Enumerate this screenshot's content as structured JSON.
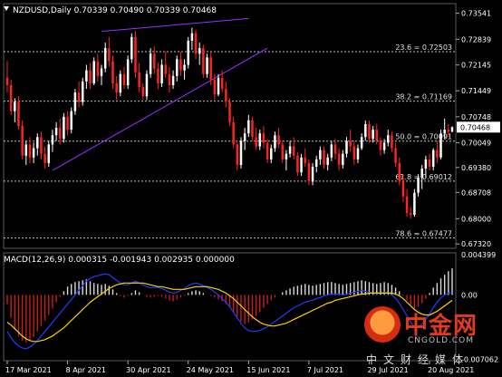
{
  "chart_data": {
    "type": "candlestick",
    "header": {
      "symbol": "NZDUSD,Daily",
      "open": "0.70339",
      "high": "0.70490",
      "low": "0.70339",
      "close": "0.70468"
    },
    "price_axis": {
      "ylim": [
        0.672,
        0.738
      ],
      "ticks": [
        "0.73541",
        "0.72839",
        "0.72145",
        "0.71449",
        "0.70748",
        "0.70049",
        "0.69380",
        "0.68708",
        "0.68000",
        "0.67320"
      ],
      "tick_values": [
        0.73541,
        0.72839,
        0.72145,
        0.71449,
        0.70748,
        0.70049,
        0.6938,
        0.68708,
        0.68,
        0.6732
      ],
      "current_price_label": "0.70468",
      "current_price": 0.70468
    },
    "x_axis": {
      "labels": [
        "17 Mar 2021",
        "8 Apr 2021",
        "30 Apr 2021",
        "24 May 2021",
        "15 Jun 2021",
        "7 Jul 2021",
        "29 Jul 2021",
        "20 Aug 2021"
      ],
      "label_bar_index": [
        0,
        16,
        32,
        48,
        64,
        80,
        96,
        112
      ],
      "bar_count": 119
    },
    "fibonacci": [
      {
        "label": "23.6 = 0.72503",
        "value": 0.72503
      },
      {
        "label": "38.2 = 0.71169",
        "value": 0.71169
      },
      {
        "label": "50.0 = 0.70091",
        "value": 0.70091
      },
      {
        "label": "61.8 = 0.69012",
        "value": 0.69012
      },
      {
        "label": "78.6 = 0.67477",
        "value": 0.67477
      }
    ],
    "trendlines": [
      {
        "from": [
          25,
          0.7305
        ],
        "to": [
          64,
          0.734
        ]
      },
      {
        "from": [
          12,
          0.693
        ],
        "to": [
          69,
          0.726
        ]
      }
    ],
    "candles_ohlc": [
      [
        0.718,
        0.7225,
        0.714,
        0.716
      ],
      [
        0.716,
        0.7175,
        0.708,
        0.709
      ],
      [
        0.709,
        0.7125,
        0.706,
        0.7115
      ],
      [
        0.7115,
        0.713,
        0.704,
        0.705
      ],
      [
        0.705,
        0.7065,
        0.696,
        0.697
      ],
      [
        0.697,
        0.701,
        0.6945,
        0.7
      ],
      [
        0.7,
        0.702,
        0.695,
        0.6965
      ],
      [
        0.6965,
        0.7005,
        0.695,
        0.699
      ],
      [
        0.699,
        0.703,
        0.697,
        0.702
      ],
      [
        0.702,
        0.7035,
        0.696,
        0.6975
      ],
      [
        0.6975,
        0.6995,
        0.6935,
        0.695
      ],
      [
        0.695,
        0.701,
        0.694,
        0.7
      ],
      [
        0.7,
        0.704,
        0.698,
        0.7025
      ],
      [
        0.7025,
        0.706,
        0.701,
        0.7045
      ],
      [
        0.7045,
        0.707,
        0.7,
        0.7015
      ],
      [
        0.7015,
        0.7085,
        0.7005,
        0.7075
      ],
      [
        0.7075,
        0.709,
        0.7025,
        0.704
      ],
      [
        0.704,
        0.71,
        0.703,
        0.709
      ],
      [
        0.709,
        0.715,
        0.708,
        0.714
      ],
      [
        0.714,
        0.717,
        0.71,
        0.7115
      ],
      [
        0.7115,
        0.718,
        0.7105,
        0.717
      ],
      [
        0.717,
        0.7215,
        0.715,
        0.72
      ],
      [
        0.72,
        0.722,
        0.715,
        0.7165
      ],
      [
        0.7165,
        0.7235,
        0.716,
        0.7225
      ],
      [
        0.7225,
        0.7245,
        0.717,
        0.7185
      ],
      [
        0.7185,
        0.7215,
        0.716,
        0.7205
      ],
      [
        0.7205,
        0.7275,
        0.7195,
        0.726
      ],
      [
        0.726,
        0.729,
        0.721,
        0.7225
      ],
      [
        0.7225,
        0.724,
        0.715,
        0.7165
      ],
      [
        0.7165,
        0.7185,
        0.712,
        0.714
      ],
      [
        0.714,
        0.72,
        0.713,
        0.719
      ],
      [
        0.719,
        0.721,
        0.715,
        0.716
      ],
      [
        0.716,
        0.724,
        0.715,
        0.723
      ],
      [
        0.723,
        0.73,
        0.722,
        0.729
      ],
      [
        0.729,
        0.7305,
        0.718,
        0.7195
      ],
      [
        0.7195,
        0.722,
        0.714,
        0.7155
      ],
      [
        0.7155,
        0.7165,
        0.712,
        0.713
      ],
      [
        0.713,
        0.72,
        0.712,
        0.719
      ],
      [
        0.719,
        0.726,
        0.718,
        0.7245
      ],
      [
        0.7245,
        0.7265,
        0.719,
        0.7205
      ],
      [
        0.7205,
        0.722,
        0.715,
        0.7165
      ],
      [
        0.7165,
        0.723,
        0.7155,
        0.7215
      ],
      [
        0.7215,
        0.725,
        0.718,
        0.719
      ],
      [
        0.719,
        0.721,
        0.714,
        0.716
      ],
      [
        0.716,
        0.72,
        0.715,
        0.7185
      ],
      [
        0.7185,
        0.724,
        0.717,
        0.723
      ],
      [
        0.723,
        0.725,
        0.7185,
        0.72
      ],
      [
        0.72,
        0.723,
        0.7175,
        0.7215
      ],
      [
        0.7215,
        0.729,
        0.7205,
        0.728
      ],
      [
        0.728,
        0.7315,
        0.7255,
        0.73
      ],
      [
        0.73,
        0.731,
        0.723,
        0.7245
      ],
      [
        0.7245,
        0.7275,
        0.7215,
        0.726
      ],
      [
        0.726,
        0.727,
        0.718,
        0.719
      ],
      [
        0.719,
        0.7245,
        0.718,
        0.7235
      ],
      [
        0.7235,
        0.725,
        0.716,
        0.7175
      ],
      [
        0.7175,
        0.719,
        0.712,
        0.7135
      ],
      [
        0.7135,
        0.719,
        0.713,
        0.718
      ],
      [
        0.718,
        0.72,
        0.714,
        0.715
      ],
      [
        0.715,
        0.717,
        0.71,
        0.7115
      ],
      [
        0.7115,
        0.7125,
        0.705,
        0.706
      ],
      [
        0.706,
        0.7075,
        0.699,
        0.7
      ],
      [
        0.7,
        0.701,
        0.693,
        0.6945
      ],
      [
        0.6945,
        0.702,
        0.6935,
        0.701
      ],
      [
        0.701,
        0.7045,
        0.6985,
        0.703
      ],
      [
        0.703,
        0.708,
        0.702,
        0.7065
      ],
      [
        0.7065,
        0.7075,
        0.701,
        0.702
      ],
      [
        0.702,
        0.7045,
        0.6985,
        0.6995
      ],
      [
        0.6995,
        0.704,
        0.6985,
        0.703
      ],
      [
        0.703,
        0.705,
        0.699,
        0.7005
      ],
      [
        0.7005,
        0.7015,
        0.695,
        0.696
      ],
      [
        0.696,
        0.7,
        0.695,
        0.699
      ],
      [
        0.699,
        0.7035,
        0.698,
        0.7025
      ],
      [
        0.7025,
        0.7045,
        0.699,
        0.7
      ],
      [
        0.7,
        0.701,
        0.695,
        0.696
      ],
      [
        0.696,
        0.6985,
        0.693,
        0.6975
      ],
      [
        0.6975,
        0.701,
        0.6965,
        0.6995
      ],
      [
        0.6995,
        0.702,
        0.696,
        0.697
      ],
      [
        0.697,
        0.698,
        0.6915,
        0.6925
      ],
      [
        0.6925,
        0.6975,
        0.6915,
        0.6965
      ],
      [
        0.6965,
        0.699,
        0.694,
        0.695
      ],
      [
        0.695,
        0.696,
        0.689,
        0.69
      ],
      [
        0.69,
        0.695,
        0.689,
        0.694
      ],
      [
        0.694,
        0.697,
        0.6925,
        0.696
      ],
      [
        0.696,
        0.6995,
        0.6945,
        0.6985
      ],
      [
        0.6985,
        0.6995,
        0.6935,
        0.6945
      ],
      [
        0.6945,
        0.6975,
        0.693,
        0.6965
      ],
      [
        0.6965,
        0.701,
        0.6955,
        0.7
      ],
      [
        0.7,
        0.7015,
        0.696,
        0.6975
      ],
      [
        0.6975,
        0.699,
        0.693,
        0.6945
      ],
      [
        0.6945,
        0.6985,
        0.6935,
        0.6975
      ],
      [
        0.6975,
        0.702,
        0.6965,
        0.701
      ],
      [
        0.701,
        0.704,
        0.698,
        0.6995
      ],
      [
        0.6995,
        0.701,
        0.6945,
        0.696
      ],
      [
        0.696,
        0.7,
        0.695,
        0.699
      ],
      [
        0.699,
        0.703,
        0.6985,
        0.702
      ],
      [
        0.702,
        0.7065,
        0.701,
        0.7055
      ],
      [
        0.7055,
        0.7065,
        0.7005,
        0.7015
      ],
      [
        0.7015,
        0.705,
        0.7005,
        0.704
      ],
      [
        0.704,
        0.7055,
        0.7,
        0.701
      ],
      [
        0.701,
        0.702,
        0.697,
        0.6985
      ],
      [
        0.6985,
        0.7015,
        0.6975,
        0.7005
      ],
      [
        0.7005,
        0.704,
        0.6995,
        0.7025
      ],
      [
        0.7025,
        0.7035,
        0.698,
        0.699
      ],
      [
        0.699,
        0.7005,
        0.694,
        0.695
      ],
      [
        0.695,
        0.6965,
        0.689,
        0.69
      ],
      [
        0.69,
        0.692,
        0.6845,
        0.686
      ],
      [
        0.686,
        0.688,
        0.6805,
        0.6815
      ],
      [
        0.6815,
        0.683,
        0.68,
        0.681
      ],
      [
        0.681,
        0.688,
        0.6805,
        0.687
      ],
      [
        0.687,
        0.692,
        0.686,
        0.691
      ],
      [
        0.691,
        0.6945,
        0.688,
        0.6935
      ],
      [
        0.6935,
        0.697,
        0.691,
        0.696
      ],
      [
        0.696,
        0.6975,
        0.693,
        0.694
      ],
      [
        0.694,
        0.699,
        0.693,
        0.6985
      ],
      [
        0.6985,
        0.701,
        0.695,
        0.6965
      ],
      [
        0.6965,
        0.704,
        0.696,
        0.703
      ],
      [
        0.703,
        0.707,
        0.7015,
        0.704
      ],
      [
        0.704,
        0.7055,
        0.702,
        0.7034
      ],
      [
        0.7034,
        0.7049,
        0.7034,
        0.70468
      ]
    ],
    "macd_panel": {
      "label": "MACD(12,26,9) 0.000315 -0.001943 0.002935 0.000000",
      "ylim": [
        -0.0072,
        0.0046
      ],
      "axis_ticks": [
        "0.004399",
        "0.00",
        "-0.007062"
      ],
      "axis_tick_values": [
        0.004399,
        0.0,
        -0.007062
      ],
      "histogram": [
        -0.001,
        -0.0025,
        -0.0038,
        -0.0045,
        -0.005,
        -0.0052,
        -0.005,
        -0.0046,
        -0.004,
        -0.0034,
        -0.0028,
        -0.0022,
        -0.0015,
        -0.0008,
        -0.0002,
        0.0004,
        0.0009,
        0.0012,
        0.0014,
        0.0015,
        0.0016,
        0.0017,
        0.0015,
        0.0013,
        0.0012,
        0.0011,
        0.0012,
        0.001,
        0.0006,
        0.0002,
        -0.0001,
        -0.0003,
        -0.0001,
        0.0002,
        0.0005,
        0.0003,
        0.0,
        -0.0002,
        -0.0003,
        -0.0002,
        -0.0001,
        -0.0002,
        -0.0004,
        -0.0006,
        -0.0007,
        -0.0005,
        -0.0003,
        -0.0001,
        0.0002,
        0.0004,
        0.0005,
        0.0004,
        0.0002,
        0.0,
        -0.0001,
        -0.0003,
        -0.0005,
        -0.0007,
        -0.001,
        -0.0014,
        -0.0019,
        -0.0024,
        -0.0029,
        -0.0032,
        -0.003,
        -0.0027,
        -0.0023,
        -0.0019,
        -0.0014,
        -0.001,
        -0.0006,
        -0.0003,
        0.0,
        0.0003,
        0.0005,
        0.0007,
        0.0009,
        0.001,
        0.0011,
        0.0012,
        0.0011,
        0.001,
        0.0011,
        0.0012,
        0.0013,
        0.0014,
        0.0014,
        0.0013,
        0.0012,
        0.0011,
        0.0012,
        0.0013,
        0.0014,
        0.0015,
        0.0016,
        0.0015,
        0.0014,
        0.0013,
        0.0012,
        0.0013,
        0.0014,
        0.0013,
        0.0011,
        0.0008,
        0.0004,
        -0.0001,
        -0.0006,
        -0.0011,
        -0.0015,
        -0.0013,
        -0.0009,
        -0.0004,
        0.0002,
        0.0008,
        0.0013,
        0.0018,
        0.0022,
        0.0026,
        0.0029
      ],
      "macd_line": [
        -0.004,
        -0.0047,
        -0.0052,
        -0.0056,
        -0.0058,
        -0.0059,
        -0.0057,
        -0.0054,
        -0.005,
        -0.0045,
        -0.004,
        -0.0035,
        -0.003,
        -0.0025,
        -0.002,
        -0.0015,
        -0.001,
        -0.0005,
        0.0,
        0.0005,
        0.001,
        0.0015,
        0.0018,
        0.002,
        0.0021,
        0.0022,
        0.0023,
        0.0022,
        0.0019,
        0.0016,
        0.0013,
        0.0011,
        0.0011,
        0.0013,
        0.0015,
        0.0013,
        0.0011,
        0.0009,
        0.0008,
        0.0008,
        0.0008,
        0.0007,
        0.0005,
        0.0003,
        0.0002,
        0.0003,
        0.0005,
        0.0007,
        0.001,
        0.0012,
        0.0013,
        0.0012,
        0.001,
        0.0008,
        0.0006,
        0.0003,
        0.0,
        -0.0004,
        -0.0008,
        -0.0013,
        -0.0019,
        -0.0025,
        -0.0031,
        -0.0036,
        -0.0039,
        -0.004,
        -0.004,
        -0.0039,
        -0.0037,
        -0.0035,
        -0.0032,
        -0.0029,
        -0.0026,
        -0.0023,
        -0.002,
        -0.0017,
        -0.0014,
        -0.0012,
        -0.001,
        -0.0008,
        -0.0007,
        -0.0006,
        -0.0004,
        -0.0003,
        -0.0001,
        0.0,
        0.0001,
        0.0001,
        0.0001,
        0.0,
        0.0001,
        0.0002,
        0.0003,
        0.0004,
        0.0005,
        0.0004,
        0.0003,
        0.0002,
        0.0001,
        0.0002,
        0.0003,
        0.0002,
        0.0,
        -0.0004,
        -0.0009,
        -0.0016,
        -0.0023,
        -0.003,
        -0.0035,
        -0.0035,
        -0.0032,
        -0.0027,
        -0.0021,
        -0.0014,
        -0.0008,
        -0.0003,
        0.0,
        0.0002,
        0.0003
      ],
      "signal_line": [
        -0.003,
        -0.0033,
        -0.0037,
        -0.0041,
        -0.0045,
        -0.0048,
        -0.005,
        -0.0051,
        -0.0051,
        -0.005,
        -0.0049,
        -0.0047,
        -0.0045,
        -0.0042,
        -0.0039,
        -0.0036,
        -0.0032,
        -0.0028,
        -0.0024,
        -0.002,
        -0.0016,
        -0.0012,
        -0.0008,
        -0.0005,
        -0.0002,
        0.0001,
        0.0004,
        0.0007,
        0.0009,
        0.0011,
        0.0012,
        0.0013,
        0.0013,
        0.0013,
        0.0013,
        0.0013,
        0.0013,
        0.0012,
        0.0011,
        0.001,
        0.0009,
        0.0009,
        0.0008,
        0.0007,
        0.0006,
        0.0006,
        0.0006,
        0.0006,
        0.0007,
        0.0008,
        0.0009,
        0.0009,
        0.0009,
        0.0009,
        0.0008,
        0.0007,
        0.0006,
        0.0004,
        0.0002,
        -0.0001,
        -0.0004,
        -0.0008,
        -0.0012,
        -0.0016,
        -0.002,
        -0.0024,
        -0.0027,
        -0.003,
        -0.0032,
        -0.0033,
        -0.0034,
        -0.0034,
        -0.0033,
        -0.0032,
        -0.0031,
        -0.0029,
        -0.0027,
        -0.0025,
        -0.0023,
        -0.0021,
        -0.0019,
        -0.0017,
        -0.0015,
        -0.0013,
        -0.0011,
        -0.0009,
        -0.0008,
        -0.0006,
        -0.0005,
        -0.0004,
        -0.0003,
        -0.0002,
        -0.0001,
        0.0,
        0.0001,
        0.0001,
        0.0002,
        0.0002,
        0.0002,
        0.0002,
        0.0002,
        0.0002,
        0.0002,
        0.0001,
        -0.0001,
        -0.0004,
        -0.0008,
        -0.0012,
        -0.0016,
        -0.0019,
        -0.0021,
        -0.0022,
        -0.0022,
        -0.002,
        -0.0018,
        -0.0015,
        -0.0012,
        -0.0009,
        -0.0006
      ]
    },
    "colors": {
      "bull_candle": "#ffffff",
      "bear_candle": "#ff2222",
      "fib_line": "#bfbfbf",
      "trendline": "#9b30ff",
      "hist_positive": "#d9d9d9",
      "hist_negative": "#c81e1e",
      "macd_line": "#1f3cff",
      "signal_line": "#ffd000",
      "axis_text": "#ffffff"
    }
  },
  "watermark": {
    "brand_cn": "中金网",
    "url": "CNGOLD.COM",
    "sub_cn": "中文财经媒体"
  }
}
